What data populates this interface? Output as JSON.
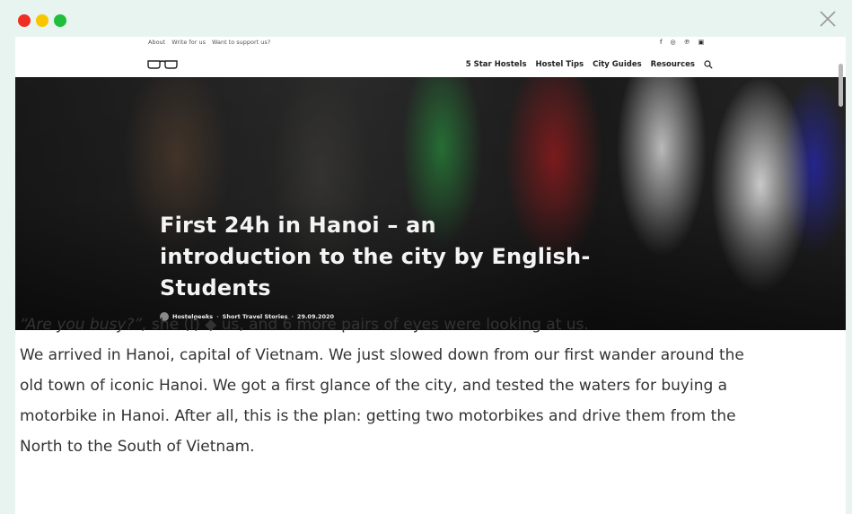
{
  "top_links": [
    "About",
    "Write for us",
    "Want to support us?"
  ],
  "social_icons": [
    "facebook-icon",
    "instagram-icon",
    "pinterest-icon",
    "youtube-icon"
  ],
  "nav": {
    "logo_icon": "glasses-logo-icon",
    "menu": [
      "5 Star Hostels",
      "Hostel Tips",
      "City Guides",
      "Resources"
    ],
    "search_icon": "search-icon"
  },
  "hero": {
    "title": "First 24h in Hanoi – an introduction to the city by English-Students",
    "author": "Hostelgeeks",
    "category": "Short Travel Stories",
    "date": "29.09.2020",
    "separator": "·"
  },
  "article": {
    "quote": "“Are you busy?”,",
    "after_quote": " she (I) ◆ us, and 6 more pairs of eyes were looking at us.",
    "lines": [
      "We arrived in Hanoi, capital of Vietnam. We just slowed down from our first wander around the",
      "old town of iconic Hanoi. We got a first glance of the city, and tested the waters for buying a",
      "motorbike in Hanoi. After all, this is the plan: getting two motorbikes and drive them from the",
      "North to the South of Vietnam."
    ]
  }
}
